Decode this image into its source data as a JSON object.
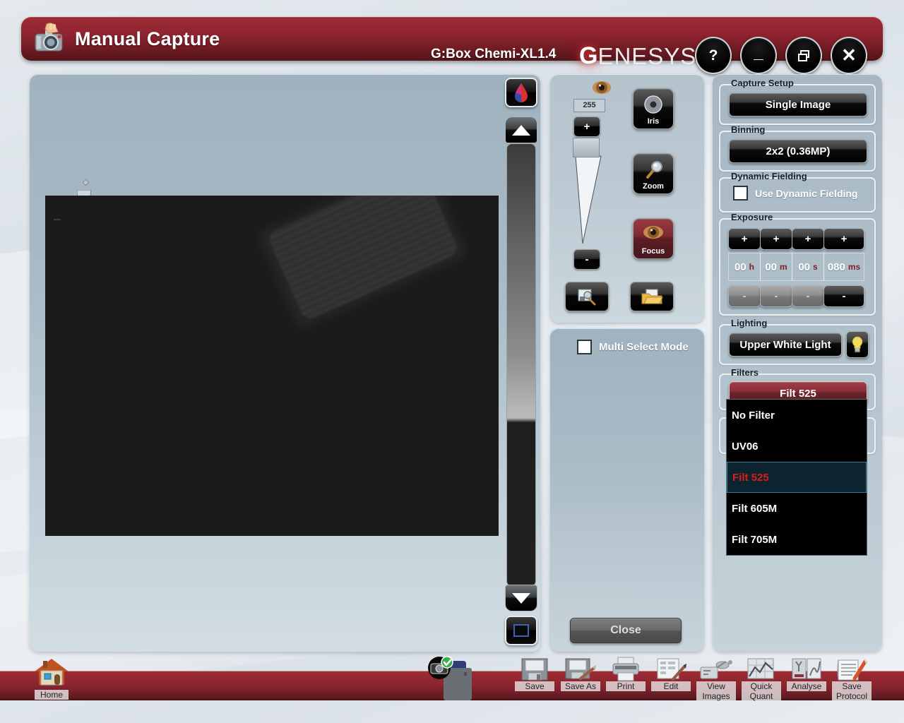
{
  "titlebar": {
    "app_icon": "camera-hand-icon",
    "title": "Manual Capture",
    "device": "G:Box Chemi-XL1.4",
    "brand_first": "G",
    "brand_rest": "ENESYS",
    "buttons": [
      {
        "name": "help-button",
        "glyph": "?"
      },
      {
        "name": "minimize-button",
        "glyph": "–"
      },
      {
        "name": "restore-button",
        "glyph": "restore-icon"
      },
      {
        "name": "close-button",
        "glyph": "✕"
      }
    ]
  },
  "image_panel": {
    "lut": {
      "lut_icon": "color-drop-icon",
      "arrow_up": "triangle-up-icon",
      "arrow_down": "triangle-down-icon",
      "range_icon": "selection-square-icon"
    }
  },
  "mid_panel": {
    "eye_icon": "eye-icon",
    "gain_value": "255",
    "plus_label": "+",
    "minus_label": "-",
    "buttons": [
      {
        "name": "iris-button",
        "label": "Iris",
        "icon": "aperture-icon"
      },
      {
        "name": "zoom-button",
        "label": "Zoom",
        "icon": "magnifier-icon"
      },
      {
        "name": "focus-button",
        "label": "Focus",
        "icon": "eye-icon"
      }
    ],
    "preview_icon": "image-preview-icon",
    "open_icon": "open-folder-icon"
  },
  "multi_panel": {
    "checkbox_label": "Multi Select Mode",
    "checked": false,
    "close_label": "Close"
  },
  "right_panel": {
    "capture_setup": {
      "title": "Capture Setup",
      "value": "Single Image"
    },
    "binning": {
      "title": "Binning",
      "value": "2x2 (0.36MP)"
    },
    "dynamic_fielding": {
      "title": "Dynamic Fielding",
      "label": "Use Dynamic Fielding",
      "checked": false
    },
    "exposure": {
      "title": "Exposure",
      "fields": [
        {
          "name": "hours",
          "value": "00",
          "unit": "h",
          "plus": "+",
          "minus": "-",
          "minus_dark": false
        },
        {
          "name": "minutes",
          "value": "00",
          "unit": "m",
          "plus": "+",
          "minus": "-",
          "minus_dark": false
        },
        {
          "name": "seconds",
          "value": "00",
          "unit": "s",
          "plus": "+",
          "minus": "-",
          "minus_dark": false
        },
        {
          "name": "milliseconds",
          "value": "080",
          "unit": "ms",
          "plus": "+",
          "minus": "-",
          "minus_dark": true
        }
      ]
    },
    "lighting": {
      "title": "Lighting",
      "value": "Upper White Light",
      "bulb_icon": "light-bulb-icon"
    },
    "filters": {
      "title": "Filters",
      "selected": "Filt 525",
      "options": [
        "No Filter",
        "UV06",
        "Filt 525",
        "Filt 605M",
        "Filt 705M"
      ],
      "selected_index": 2
    }
  },
  "bottombar": {
    "home": {
      "label": "Home",
      "icon": "house-icon"
    },
    "status_icon": "camera-ok-icon",
    "items": [
      {
        "name": "save-button",
        "line1": "Save",
        "line2": "",
        "icon": "floppy-icon"
      },
      {
        "name": "save-as-button",
        "line1": "Save As",
        "line2": "",
        "icon": "floppy-pencil-icon"
      },
      {
        "name": "print-button",
        "line1": "Print",
        "line2": "",
        "icon": "printer-icon"
      },
      {
        "name": "edit-button",
        "line1": "Edit",
        "line2": "",
        "icon": "edit-pencil-icon"
      },
      {
        "name": "view-images-button",
        "line1": "View",
        "line2": "Images",
        "icon": "film-icon"
      },
      {
        "name": "quick-quant-button",
        "line1": "Quick",
        "line2": "Quant",
        "icon": "chart-icon"
      },
      {
        "name": "analyse-button",
        "line1": "Analyse",
        "line2": "",
        "icon": "analysis-icon"
      },
      {
        "name": "save-protocol-button",
        "line1": "Save",
        "line2": "Protocol",
        "icon": "notepad-pencil-icon"
      }
    ]
  },
  "colors": {
    "brand_red": "#8e2430",
    "panel_blue": "#a7b8c4",
    "accent_red": "#e01b1b",
    "unit_red": "#7c1f26"
  }
}
